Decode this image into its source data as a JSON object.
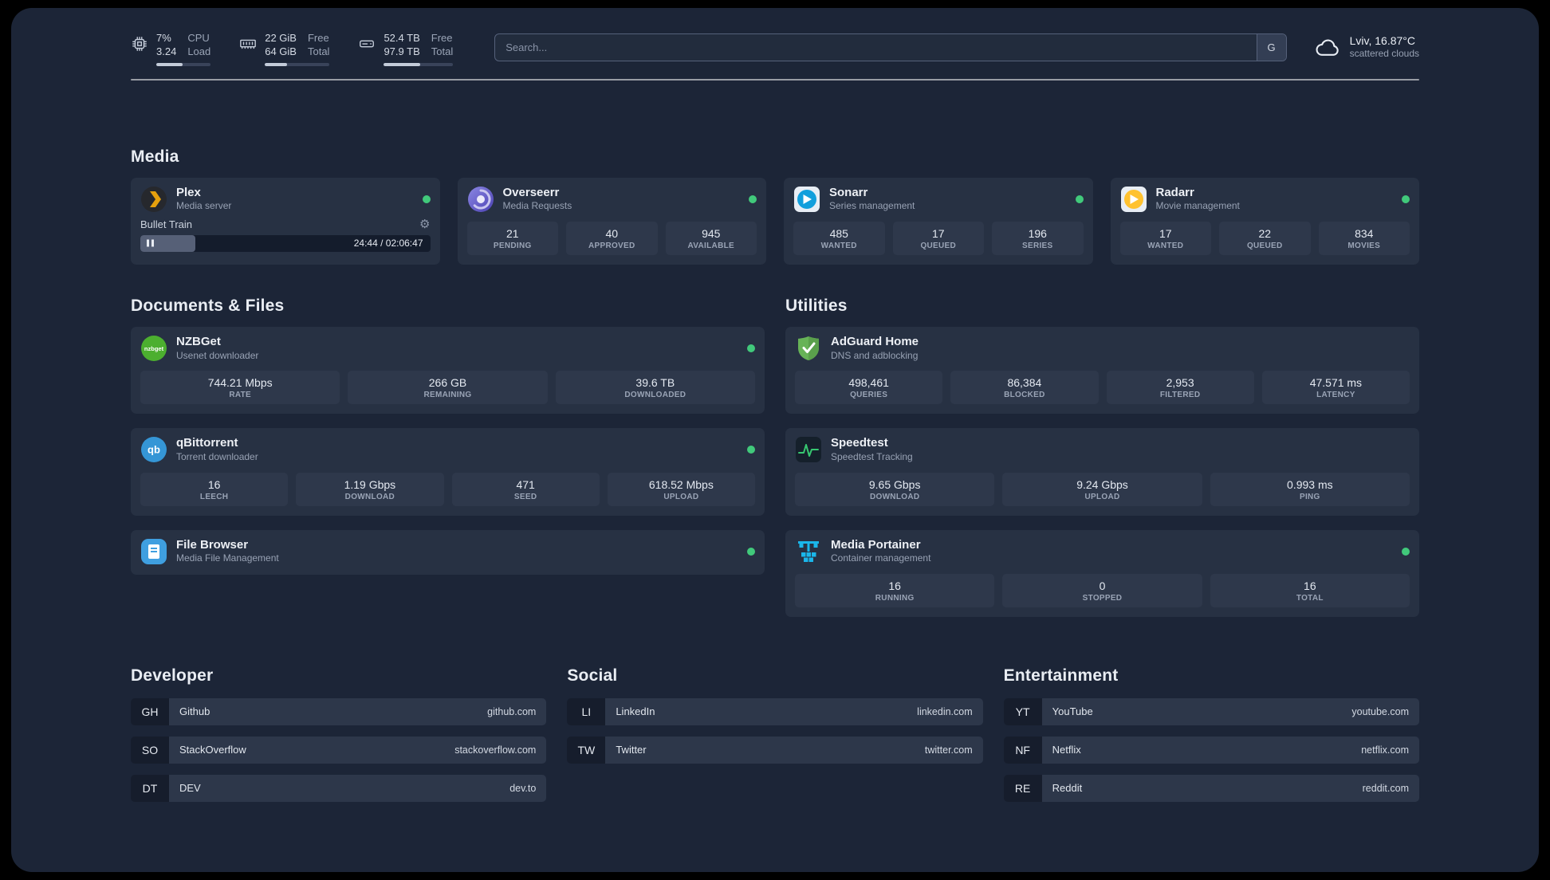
{
  "colors": {
    "background": "#1c2537",
    "card": "#273143",
    "stat_block": "#2e384b",
    "status_online": "#41c97b",
    "plex_gold": "#e5a00d"
  },
  "icons": {
    "gear": "⚙"
  },
  "topbar": {
    "system": [
      {
        "icon": "cpu-icon",
        "value": "7%",
        "sub": "3.24",
        "label_top": "CPU",
        "label_bottom": "Load",
        "progress_pct": 48
      },
      {
        "icon": "memory-icon",
        "value": "22 GiB",
        "sub": "64 GiB",
        "label_top": "Free",
        "label_bottom": "Total",
        "progress_pct": 34
      },
      {
        "icon": "disk-icon",
        "value": "52.4 TB",
        "sub": "97.9 TB",
        "label_top": "Free",
        "label_bottom": "Total",
        "progress_pct": 53
      }
    ],
    "search": {
      "placeholder": "Search...",
      "provider_button": "G"
    },
    "weather": {
      "location": "Lviv, 16.87°C",
      "condition": "scattered clouds"
    }
  },
  "groups": {
    "media": {
      "title": "Media",
      "services": [
        {
          "name": "Plex",
          "description": "Media server",
          "online": true,
          "player": {
            "track": "Bullet Train",
            "time": "24:44 / 02:06:47",
            "progress_pct": 19
          }
        },
        {
          "name": "Overseerr",
          "description": "Media Requests",
          "online": true,
          "stats": [
            {
              "value": "21",
              "label": "PENDING"
            },
            {
              "value": "40",
              "label": "APPROVED"
            },
            {
              "value": "945",
              "label": "AVAILABLE"
            }
          ]
        },
        {
          "name": "Sonarr",
          "description": "Series management",
          "online": true,
          "stats": [
            {
              "value": "485",
              "label": "WANTED"
            },
            {
              "value": "17",
              "label": "QUEUED"
            },
            {
              "value": "196",
              "label": "SERIES"
            }
          ]
        },
        {
          "name": "Radarr",
          "description": "Movie management",
          "online": true,
          "stats": [
            {
              "value": "17",
              "label": "WANTED"
            },
            {
              "value": "22",
              "label": "QUEUED"
            },
            {
              "value": "834",
              "label": "MOVIES"
            }
          ]
        }
      ]
    },
    "documents": {
      "title": "Documents & Files",
      "services": [
        {
          "name": "NZBGet",
          "description": "Usenet downloader",
          "online": true,
          "stats": [
            {
              "value": "744.21 Mbps",
              "label": "RATE"
            },
            {
              "value": "266 GB",
              "label": "REMAINING"
            },
            {
              "value": "39.6 TB",
              "label": "DOWNLOADED"
            }
          ]
        },
        {
          "name": "qBittorrent",
          "description": "Torrent downloader",
          "online": true,
          "stats": [
            {
              "value": "16",
              "label": "LEECH"
            },
            {
              "value": "1.19 Gbps",
              "label": "DOWNLOAD"
            },
            {
              "value": "471",
              "label": "SEED"
            },
            {
              "value": "618.52 Mbps",
              "label": "UPLOAD"
            }
          ]
        },
        {
          "name": "File Browser",
          "description": "Media File Management",
          "online": true,
          "stats": []
        }
      ]
    },
    "utilities": {
      "title": "Utilities",
      "services": [
        {
          "name": "AdGuard Home",
          "description": "DNS and adblocking",
          "online": false,
          "stats": [
            {
              "value": "498,461",
              "label": "QUERIES"
            },
            {
              "value": "86,384",
              "label": "BLOCKED"
            },
            {
              "value": "2,953",
              "label": "FILTERED"
            },
            {
              "value": "47.571 ms",
              "label": "LATENCY"
            }
          ]
        },
        {
          "name": "Speedtest",
          "description": "Speedtest Tracking",
          "online": false,
          "stats": [
            {
              "value": "9.65 Gbps",
              "label": "DOWNLOAD"
            },
            {
              "value": "9.24 Gbps",
              "label": "UPLOAD"
            },
            {
              "value": "0.993 ms",
              "label": "PING"
            }
          ]
        },
        {
          "name": "Media Portainer",
          "description": "Container management",
          "online": true,
          "stats": [
            {
              "value": "16",
              "label": "RUNNING"
            },
            {
              "value": "0",
              "label": "STOPPED"
            },
            {
              "value": "16",
              "label": "TOTAL"
            }
          ]
        }
      ]
    }
  },
  "bookmarks": [
    {
      "title": "Developer",
      "items": [
        {
          "abbr": "GH",
          "name": "Github",
          "domain": "github.com"
        },
        {
          "abbr": "SO",
          "name": "StackOverflow",
          "domain": "stackoverflow.com"
        },
        {
          "abbr": "DT",
          "name": "DEV",
          "domain": "dev.to"
        }
      ]
    },
    {
      "title": "Social",
      "items": [
        {
          "abbr": "LI",
          "name": "LinkedIn",
          "domain": "linkedin.com"
        },
        {
          "abbr": "TW",
          "name": "Twitter",
          "domain": "twitter.com"
        }
      ]
    },
    {
      "title": "Entertainment",
      "items": [
        {
          "abbr": "YT",
          "name": "YouTube",
          "domain": "youtube.com"
        },
        {
          "abbr": "NF",
          "name": "Netflix",
          "domain": "netflix.com"
        },
        {
          "abbr": "RE",
          "name": "Reddit",
          "domain": "reddit.com"
        }
      ]
    }
  ]
}
